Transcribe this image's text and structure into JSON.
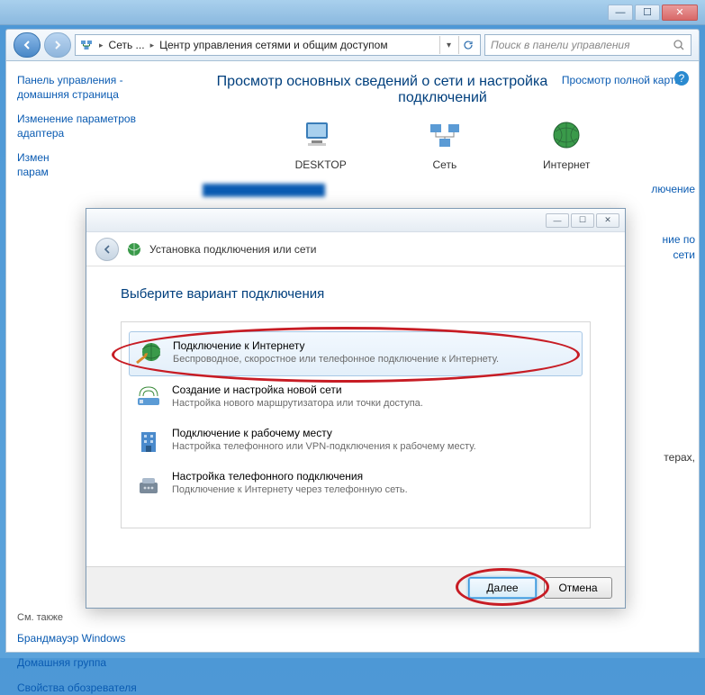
{
  "titlebar": {
    "min": "—",
    "max": "☐",
    "close": "✕"
  },
  "toolbar": {
    "addr_segments": {
      "seg1": "Сеть ...",
      "seg2": "Центр управления сетями и общим доступом"
    },
    "search_placeholder": "Поиск в панели управления"
  },
  "sidebar": {
    "link1": "Панель управления - домашняя страница",
    "link2": "Изменение параметров адаптера",
    "link3_part1": "Измен",
    "link3_part2": "парам",
    "see_also": "См. также",
    "bottom1": "Брандмауэр Windows",
    "bottom2": "Домашняя группа",
    "bottom3": "Свойства обозревателя"
  },
  "main": {
    "title": "Просмотр основных сведений о сети и настройка подключений",
    "view_map": "Просмотр полной карты",
    "net_desktop": "DESKTOP",
    "net_net": "Сеть",
    "net_internet": "Интернет",
    "partial_right1": "лючение",
    "partial_right2a": "ние по",
    "partial_right2b": "сети",
    "partial_right3": "терах,"
  },
  "wizard": {
    "title_controls": {
      "min": "—",
      "max": "☐",
      "close": "✕"
    },
    "header_title": "Установка подключения или сети",
    "heading": "Выберите вариант подключения",
    "items": [
      {
        "title": "Подключение к Интернету",
        "desc": "Беспроводное, скоростное или телефонное подключение к Интернету."
      },
      {
        "title": "Создание и настройка новой сети",
        "desc": "Настройка нового маршрутизатора или точки доступа."
      },
      {
        "title": "Подключение к рабочему месту",
        "desc": "Настройка телефонного или VPN-подключения к рабочему месту."
      },
      {
        "title": "Настройка телефонного подключения",
        "desc": "Подключение к Интернету через телефонную сеть."
      }
    ],
    "btn_next": "Далее",
    "btn_cancel": "Отмена"
  }
}
